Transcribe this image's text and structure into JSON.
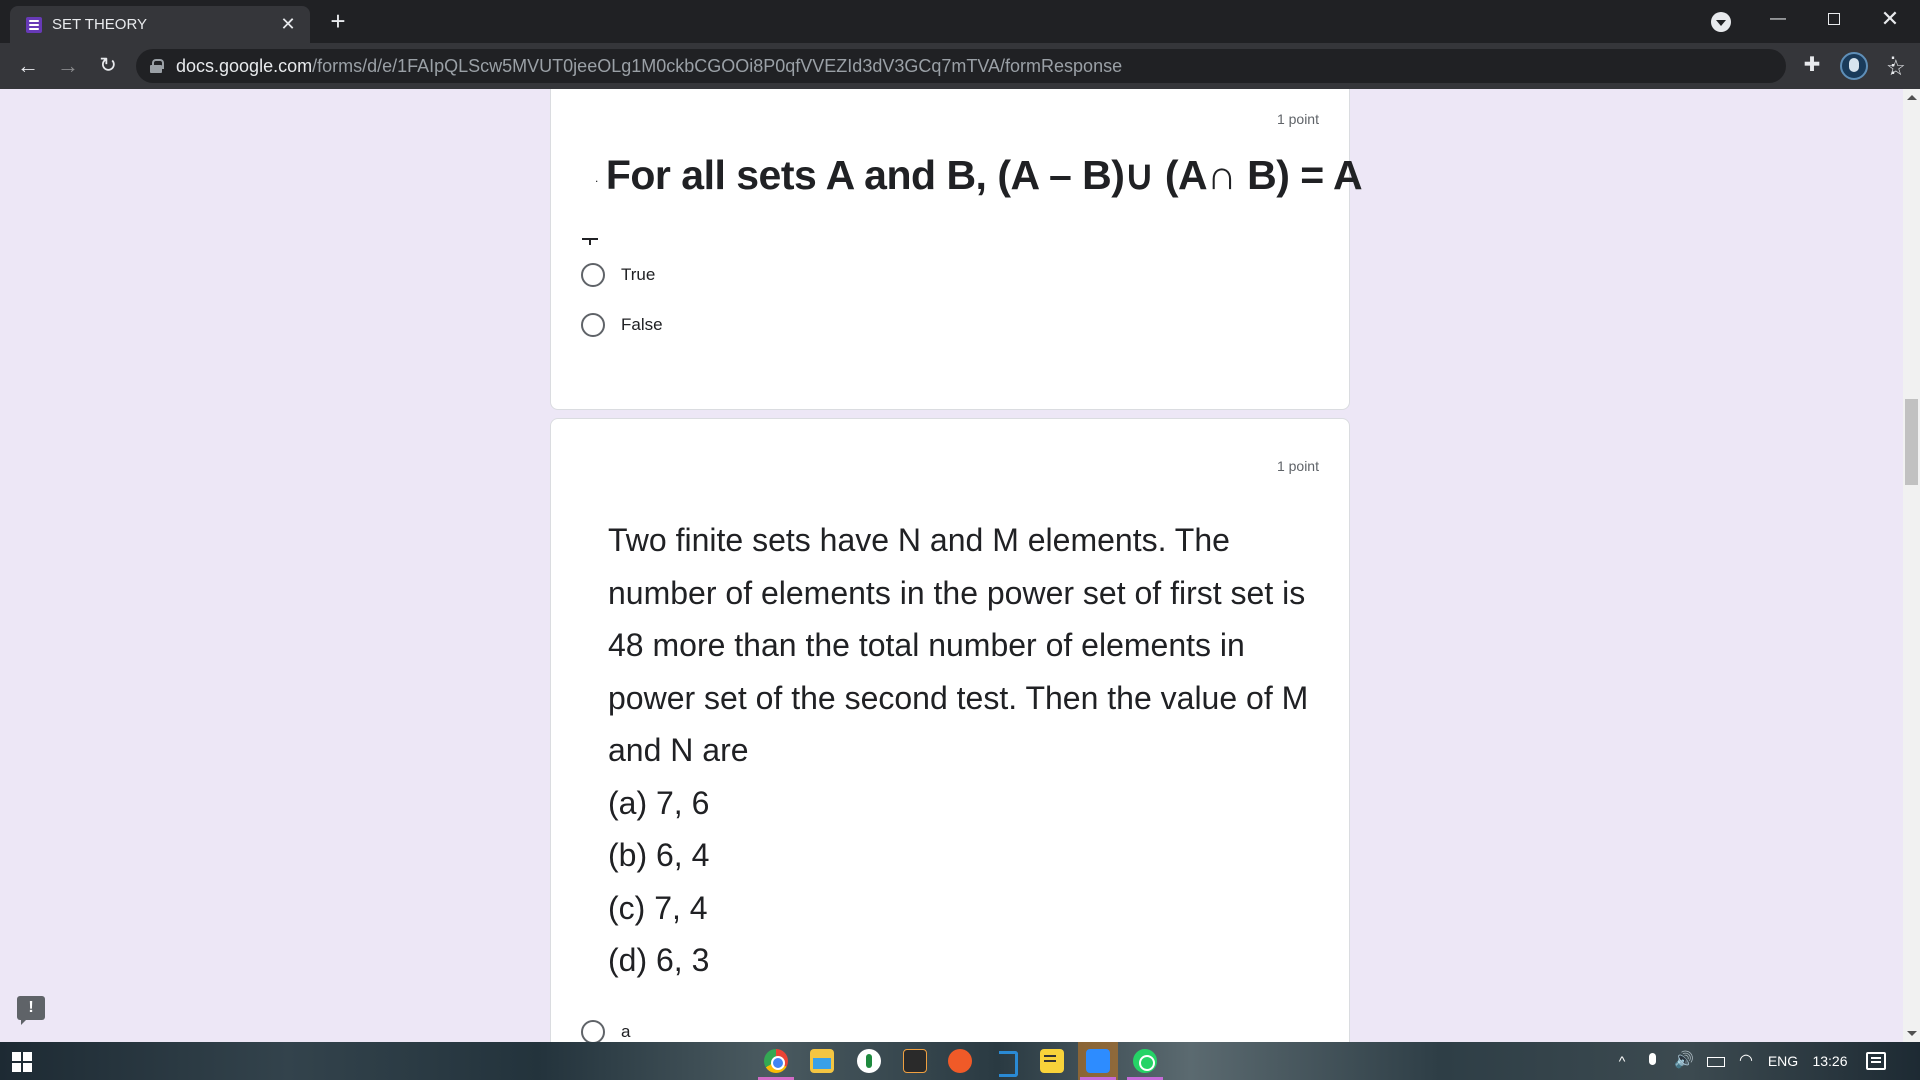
{
  "browser": {
    "tab_title": "SET THEORY",
    "tab_close": "✕",
    "new_tab": "+",
    "url_host": "docs.google.com",
    "url_path": "/forms/d/e/1FAIpQLScw5MVUT0jeeOLg1M0ckbCGOOi8P0qfVVEZId3dV3GCq7mTVA/formResponse",
    "back": "←",
    "forward": "→",
    "reload": "↻",
    "star": "☆",
    "extensions": "✚",
    "menu": "⋮",
    "minimize": "—",
    "close": "✕"
  },
  "question1": {
    "points": "1 point",
    "lead": ".",
    "title": "For all sets A and B, (A – B)∪ (A∩ B) = A",
    "options": [
      "True",
      "False"
    ]
  },
  "question2": {
    "points": "1 point",
    "text": "Two finite sets have N and M elements. The number of elements in the power set of first set is 48 more than the total number of elements in power set of the second test. Then the value of M and N are",
    "choices": [
      "(a) 7, 6",
      "(b) 6, 4",
      "(c) 7, 4",
      "(d) 6, 3"
    ],
    "first_option": "a"
  },
  "feedback_label": "!",
  "taskbar": {
    "tray_chevron": "^",
    "volume": "🔊",
    "wifi": "◠",
    "language": "ENG",
    "time": "13:26"
  },
  "colors": {
    "form_background": "#ede7f6",
    "form_accent": "#673ab7",
    "browser_frame": "#202124",
    "toolbar": "#35363a"
  }
}
